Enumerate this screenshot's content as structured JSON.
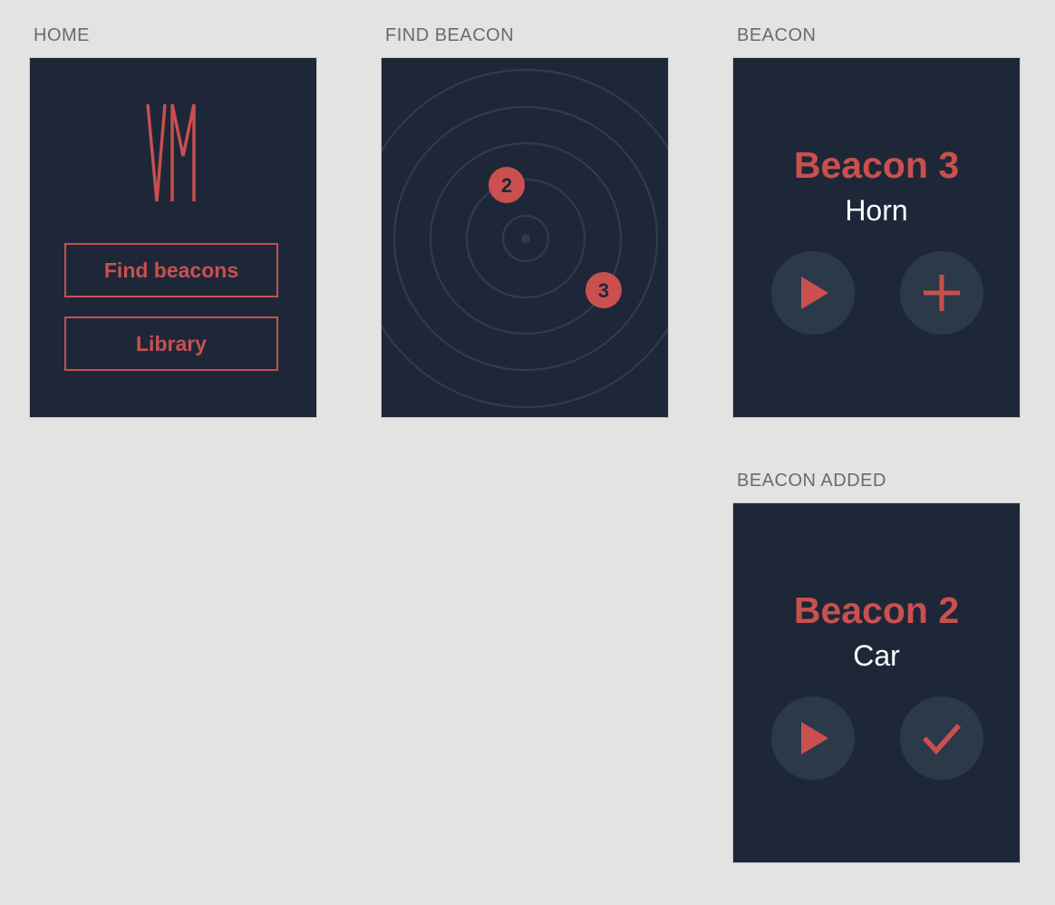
{
  "colors": {
    "canvas": "#e3e3e3",
    "screen_bg": "#1e2738",
    "accent": "#c9504f",
    "circle_button_bg": "#2b3949",
    "ring": "#2f3c4d",
    "label": "#6b6b6b"
  },
  "home": {
    "label": "HOME",
    "logo_text": "VM",
    "find_beacons_label": "Find beacons",
    "library_label": "Library"
  },
  "find_beacon": {
    "label": "FIND BEACON",
    "markers": [
      {
        "number": "2"
      },
      {
        "number": "3"
      }
    ]
  },
  "beacon": {
    "label": "BEACON",
    "title": "Beacon 3",
    "subtitle": "Horn",
    "play_icon": "play-icon",
    "action_icon": "plus-icon"
  },
  "beacon_added": {
    "label": "BEACON ADDED",
    "title": "Beacon 2",
    "subtitle": "Car",
    "play_icon": "play-icon",
    "action_icon": "checkmark-icon"
  }
}
